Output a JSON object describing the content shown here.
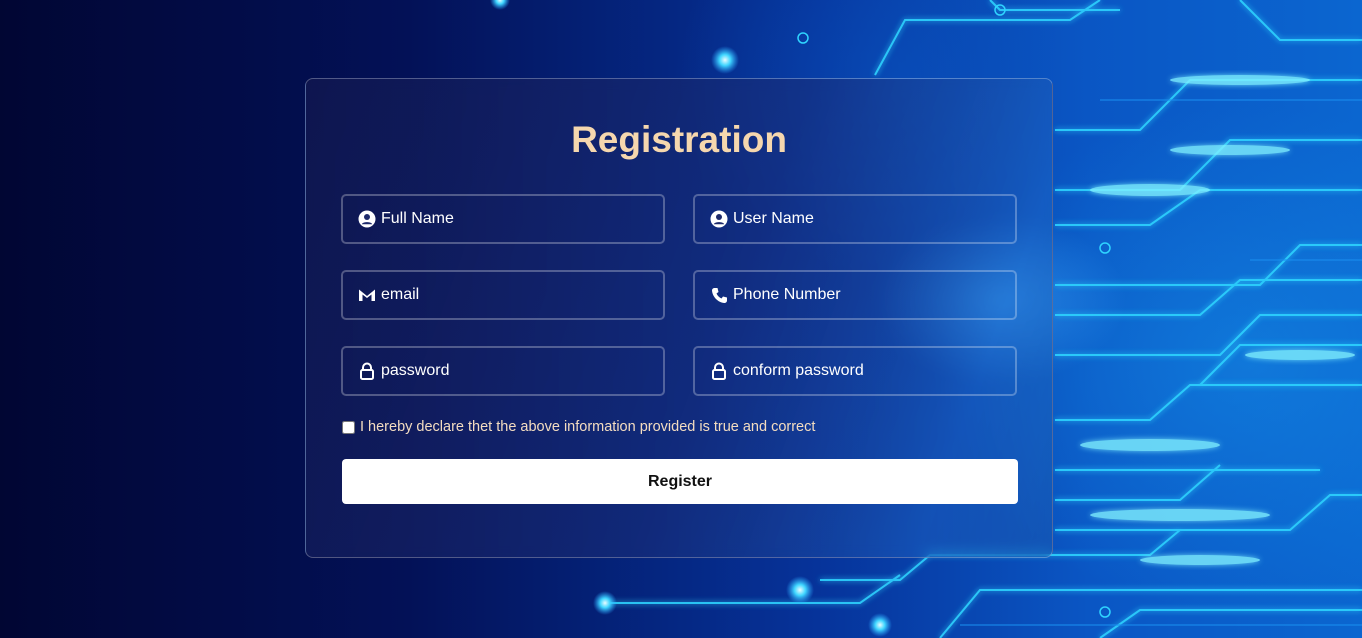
{
  "form": {
    "title": "Registration",
    "fields": {
      "full_name": {
        "placeholder": "Full Name",
        "icon": "user-circle-icon"
      },
      "user_name": {
        "placeholder": "User Name",
        "icon": "user-circle-icon"
      },
      "email": {
        "placeholder": "email",
        "icon": "gmail-icon"
      },
      "phone": {
        "placeholder": "Phone Number",
        "icon": "phone-icon"
      },
      "password": {
        "placeholder": "password",
        "icon": "lock-icon"
      },
      "confirm_password": {
        "placeholder": "conform password",
        "icon": "lock-icon"
      }
    },
    "declaration_label": "I hereby declare thet the above information provided is true and correct",
    "declaration_checked": false,
    "submit_label": "Register"
  },
  "colors": {
    "title": "#f5d7ae",
    "declaration_text": "#f3dcc0",
    "button_bg": "#ffffff",
    "background_dark": "#02083a",
    "circuit_glow": "#2fd4ff"
  }
}
